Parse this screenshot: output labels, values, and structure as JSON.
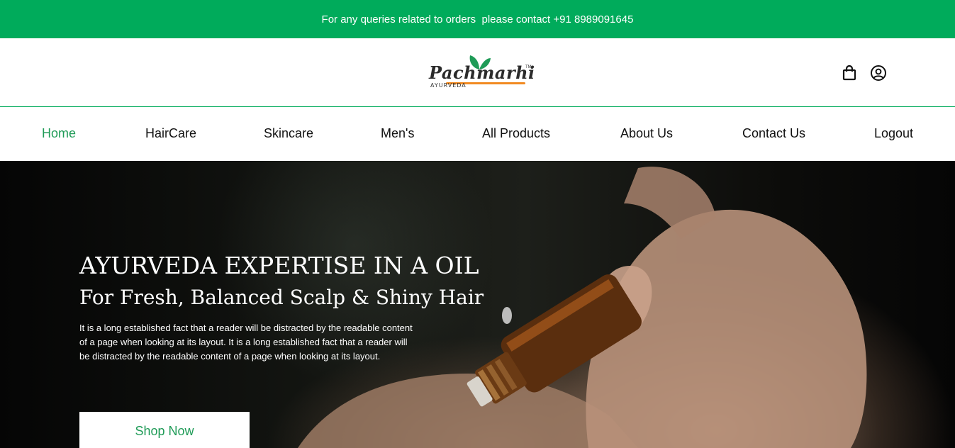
{
  "topbar": {
    "text": "For any queries related to orders  please contact +91 8989091645"
  },
  "brand": {
    "name": "Pachmarhi",
    "tagline": "AYURVEDA",
    "trademark": "TM"
  },
  "header_icons": {
    "cart": "shopping-bag-icon",
    "account": "user-circle-icon"
  },
  "nav": {
    "items": [
      {
        "label": "Home",
        "active": true
      },
      {
        "label": "HairCare"
      },
      {
        "label": "Skincare"
      },
      {
        "label": "Men's"
      },
      {
        "label": "All Products"
      },
      {
        "label": "About Us"
      },
      {
        "label": "Contact Us"
      },
      {
        "label": "Logout"
      }
    ]
  },
  "hero": {
    "title": "AYURVEDA EXPERTISE IN A OIL",
    "subtitle": "For Fresh, Balanced Scalp & Shiny Hair",
    "body": "It is a long established fact that a reader will be distracted by the readable content of a page when looking at its layout. It is a long established fact that a reader will be distracted by the readable content of a page when looking at its layout.",
    "cta": "Shop Now"
  },
  "colors": {
    "accent": "#00ab5b",
    "nav_active": "#1f9b57",
    "logo_underline": "#f18a21"
  }
}
